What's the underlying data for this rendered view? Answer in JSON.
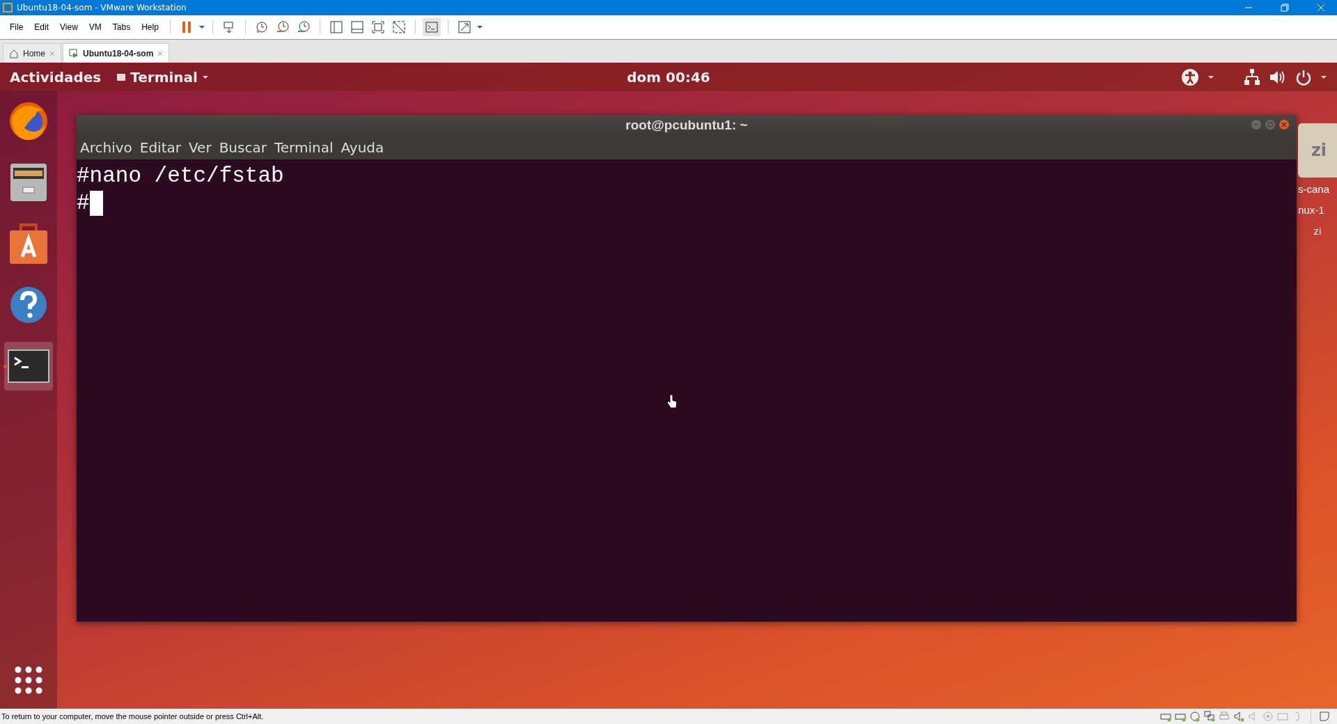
{
  "window": {
    "title": "Ubuntu18-04-som - VMware Workstation"
  },
  "menu": [
    "File",
    "Edit",
    "View",
    "VM",
    "Tabs",
    "Help"
  ],
  "tabs": [
    {
      "label": "Home",
      "selected": false
    },
    {
      "label": "Ubuntu18-04-som",
      "selected": true
    }
  ],
  "guest": {
    "activities": "Actividades",
    "app_menu": "Terminal",
    "clock": "dom 00:46",
    "dock": [
      {
        "kind": "browser",
        "running": false
      },
      {
        "kind": "files",
        "running": false
      },
      {
        "kind": "store",
        "running": false
      },
      {
        "kind": "help",
        "running": false
      },
      {
        "kind": "terminal",
        "running": true
      }
    ],
    "terminal": {
      "title": "root@pcubuntu1: ~",
      "menu": [
        "Archivo",
        "Editar",
        "Ver",
        "Buscar",
        "Terminal",
        "Ayuda"
      ],
      "lines": [
        "#nano /etc/fstab",
        "#"
      ]
    },
    "desktop_icon": {
      "badge": "zi",
      "label_lines": [
        "s-cana",
        "nux-1",
        "zi"
      ]
    }
  },
  "status_bar": {
    "message": "To return to your computer, move the mouse pointer outside or press Ctrl+Alt."
  }
}
